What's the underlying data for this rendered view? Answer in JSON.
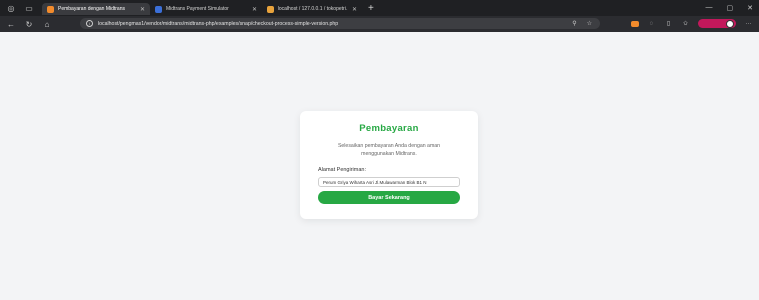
{
  "browser": {
    "tabs": [
      {
        "title": "Pembayaran dengan Midtrans",
        "favicon_color": "#f28b2c",
        "active": true
      },
      {
        "title": "Midtrans Payment Simulator",
        "favicon_color": "#3b6fd8",
        "active": false
      },
      {
        "title": "localhost / 127.0.0.1 / tokopetri…",
        "favicon_color": "#e8a33c",
        "active": false
      }
    ],
    "url": "localhost/pengmas1/vendor/midtrans/midtrans-php/examples/snap/checkout-process-simple-version.php"
  },
  "payment": {
    "title": "Pembayaran",
    "description": "Selesaikan pembayaran Anda dengan aman menggunakan Midtrans.",
    "address_label": "Alamat Pengiriman:",
    "address_value": "Perum Griya Wiharta Asri Jl.Mulawarman Blok B1 N",
    "pay_button": "Bayar Sekarang"
  },
  "colors": {
    "accent": "#27a844"
  }
}
